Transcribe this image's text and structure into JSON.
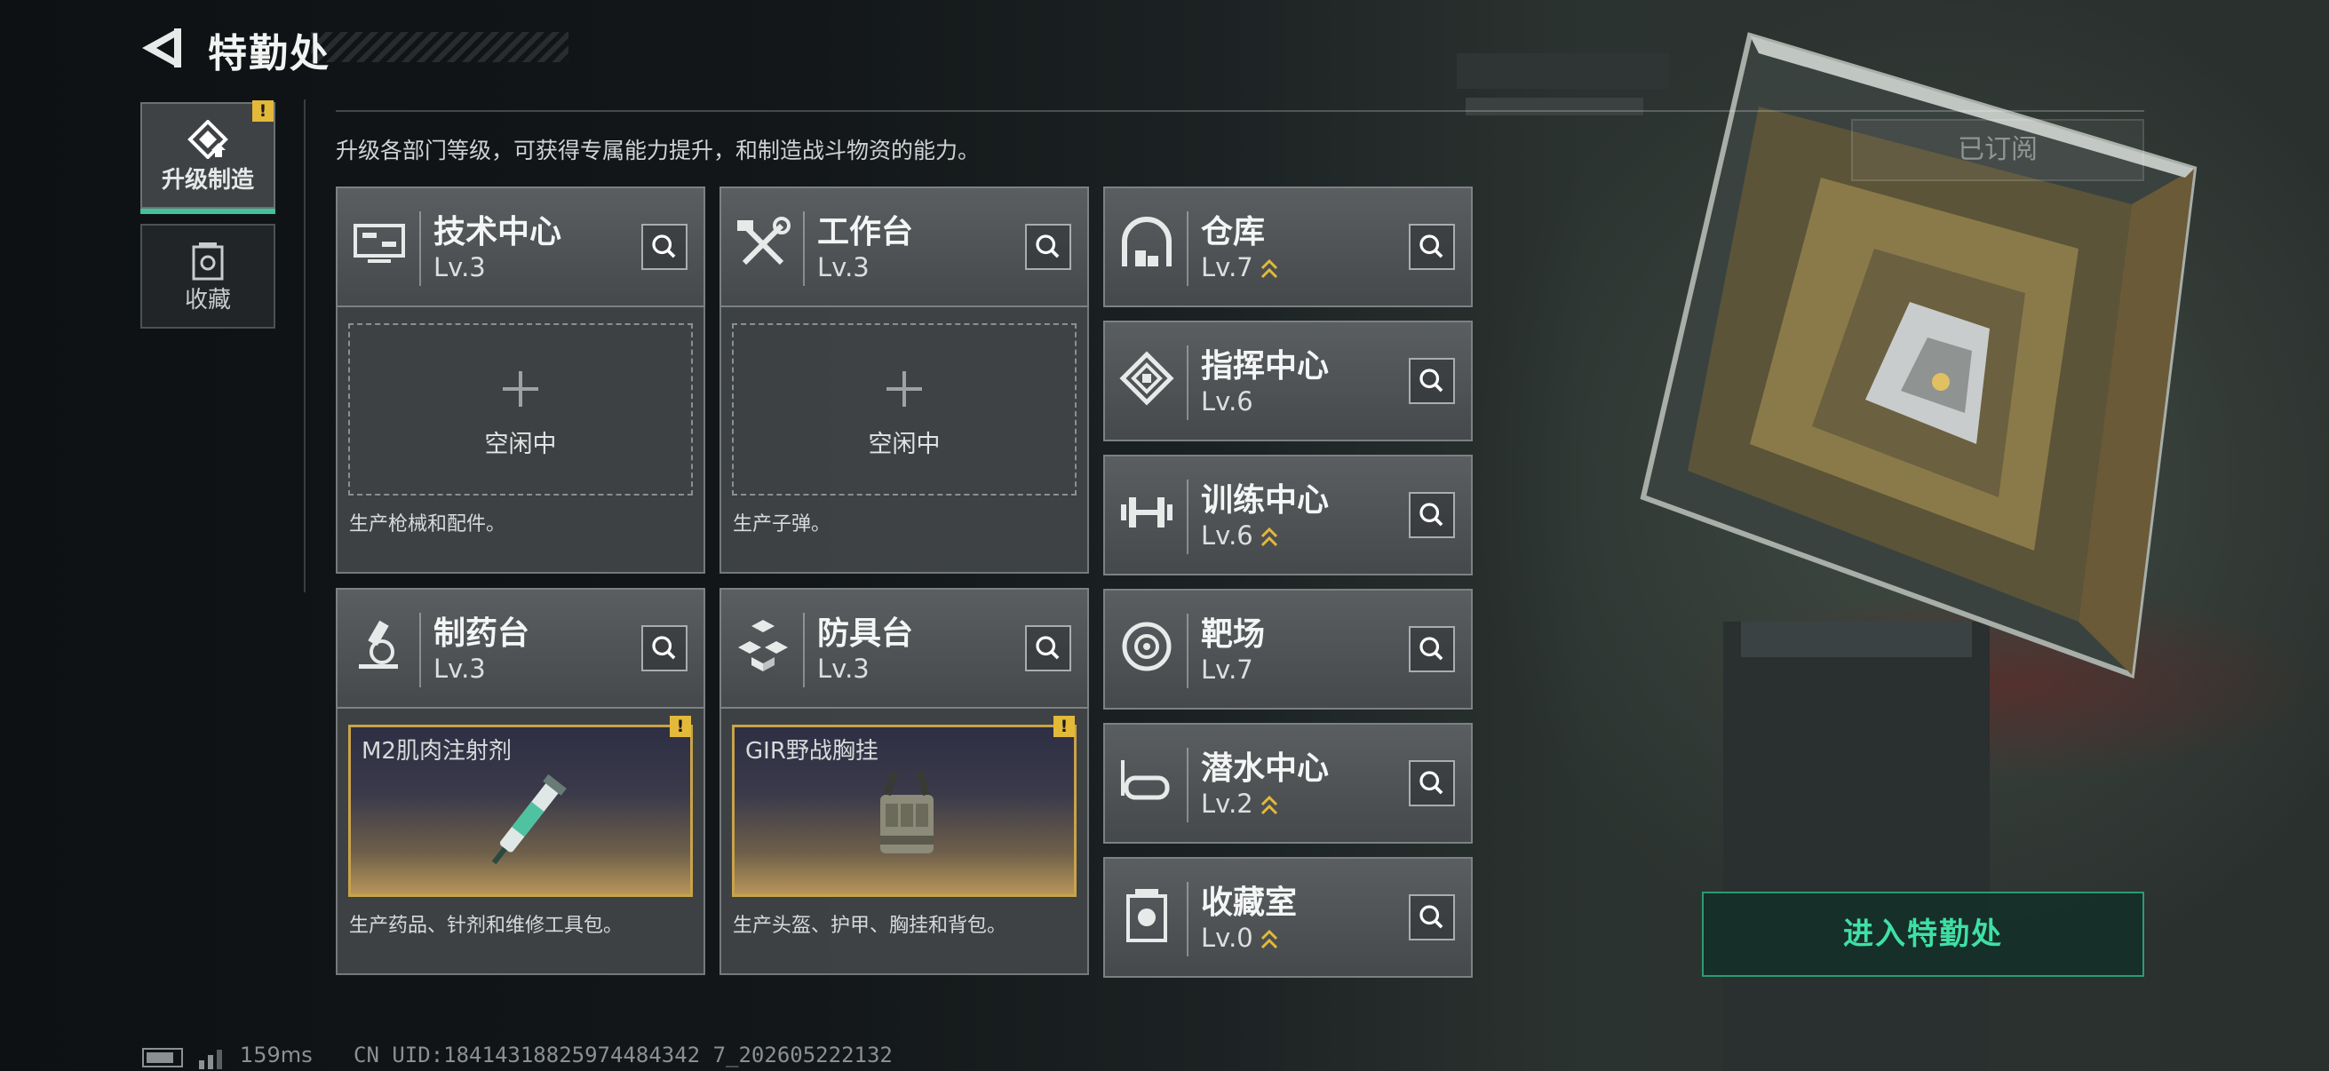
{
  "header": {
    "title": "特勤处"
  },
  "nav": {
    "upgrade_label": "升级制造",
    "upgrade_alert": "!",
    "collection_label": "收藏"
  },
  "description": "升级各部门等级，可获得专属能力提升，和制造战斗物资的能力。",
  "subscribed_label": "已订阅",
  "enter_button": "进入特勤处",
  "departments": {
    "tech_center": {
      "name": "技术中心",
      "level": "Lv.3",
      "icon": "monitor-icon",
      "slot_status": "空闲中",
      "note": "生产枪械和配件。"
    },
    "workbench": {
      "name": "工作台",
      "level": "Lv.3",
      "icon": "hammer-wrench-icon",
      "slot_status": "空闲中",
      "note": "生产子弹。"
    },
    "pharmacy": {
      "name": "制药台",
      "level": "Lv.3",
      "icon": "microscope-icon",
      "product": "M2肌肉注射剂",
      "product_alert": "!",
      "note": "生产药品、针剂和维修工具包。"
    },
    "armor_bench": {
      "name": "防具台",
      "level": "Lv.3",
      "icon": "armor-cubes-icon",
      "product": "GIR野战胸挂",
      "product_alert": "!",
      "note": "生产头盔、护甲、胸挂和背包。"
    },
    "warehouse": {
      "name": "仓库",
      "level": "Lv.7",
      "icon": "warehouse-icon",
      "upgradable": true
    },
    "command_center": {
      "name": "指挥中心",
      "level": "Lv.6",
      "icon": "chip-icon",
      "upgradable": false
    },
    "training_center": {
      "name": "训练中心",
      "level": "Lv.6",
      "icon": "dumbbell-icon",
      "upgradable": true
    },
    "shooting_range": {
      "name": "靶场",
      "level": "Lv.7",
      "icon": "target-icon",
      "upgradable": false
    },
    "diving_center": {
      "name": "潜水中心",
      "level": "Lv.2",
      "icon": "diving-mask-icon",
      "upgradable": true
    },
    "collection_room": {
      "name": "收藏室",
      "level": "Lv.0",
      "icon": "trophy-case-icon",
      "upgradable": true
    }
  },
  "status_bar": {
    "ping": "159ms",
    "uid": "CN UID:18414318825974484342 7_202605222132"
  },
  "colors": {
    "accent_green": "#3fc29a",
    "gold_frame": "#c9a34a",
    "alert_yellow": "#e3b93a",
    "enter_text": "#3fe0a5"
  }
}
